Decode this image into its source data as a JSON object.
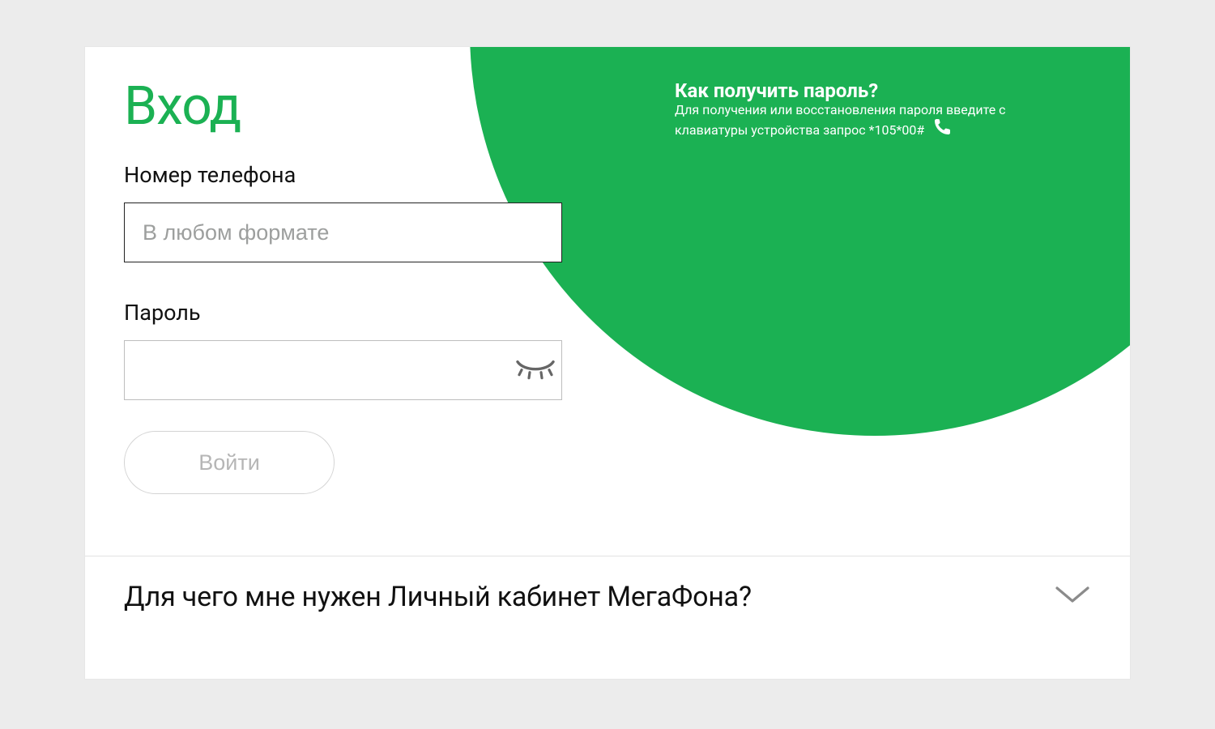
{
  "colors": {
    "accent": "#1bb153"
  },
  "login": {
    "title": "Вход",
    "phone_label": "Номер телефона",
    "phone_placeholder": "В любом формате",
    "password_label": "Пароль",
    "submit_label": "Войти"
  },
  "callout": {
    "title": "Как получить пароль?",
    "body": "Для получения или восстановления пароля введите с клавиатуры устройства запрос *105*00#"
  },
  "accordion": {
    "question": "Для чего мне нужен Личный кабинет МегаФона?"
  }
}
